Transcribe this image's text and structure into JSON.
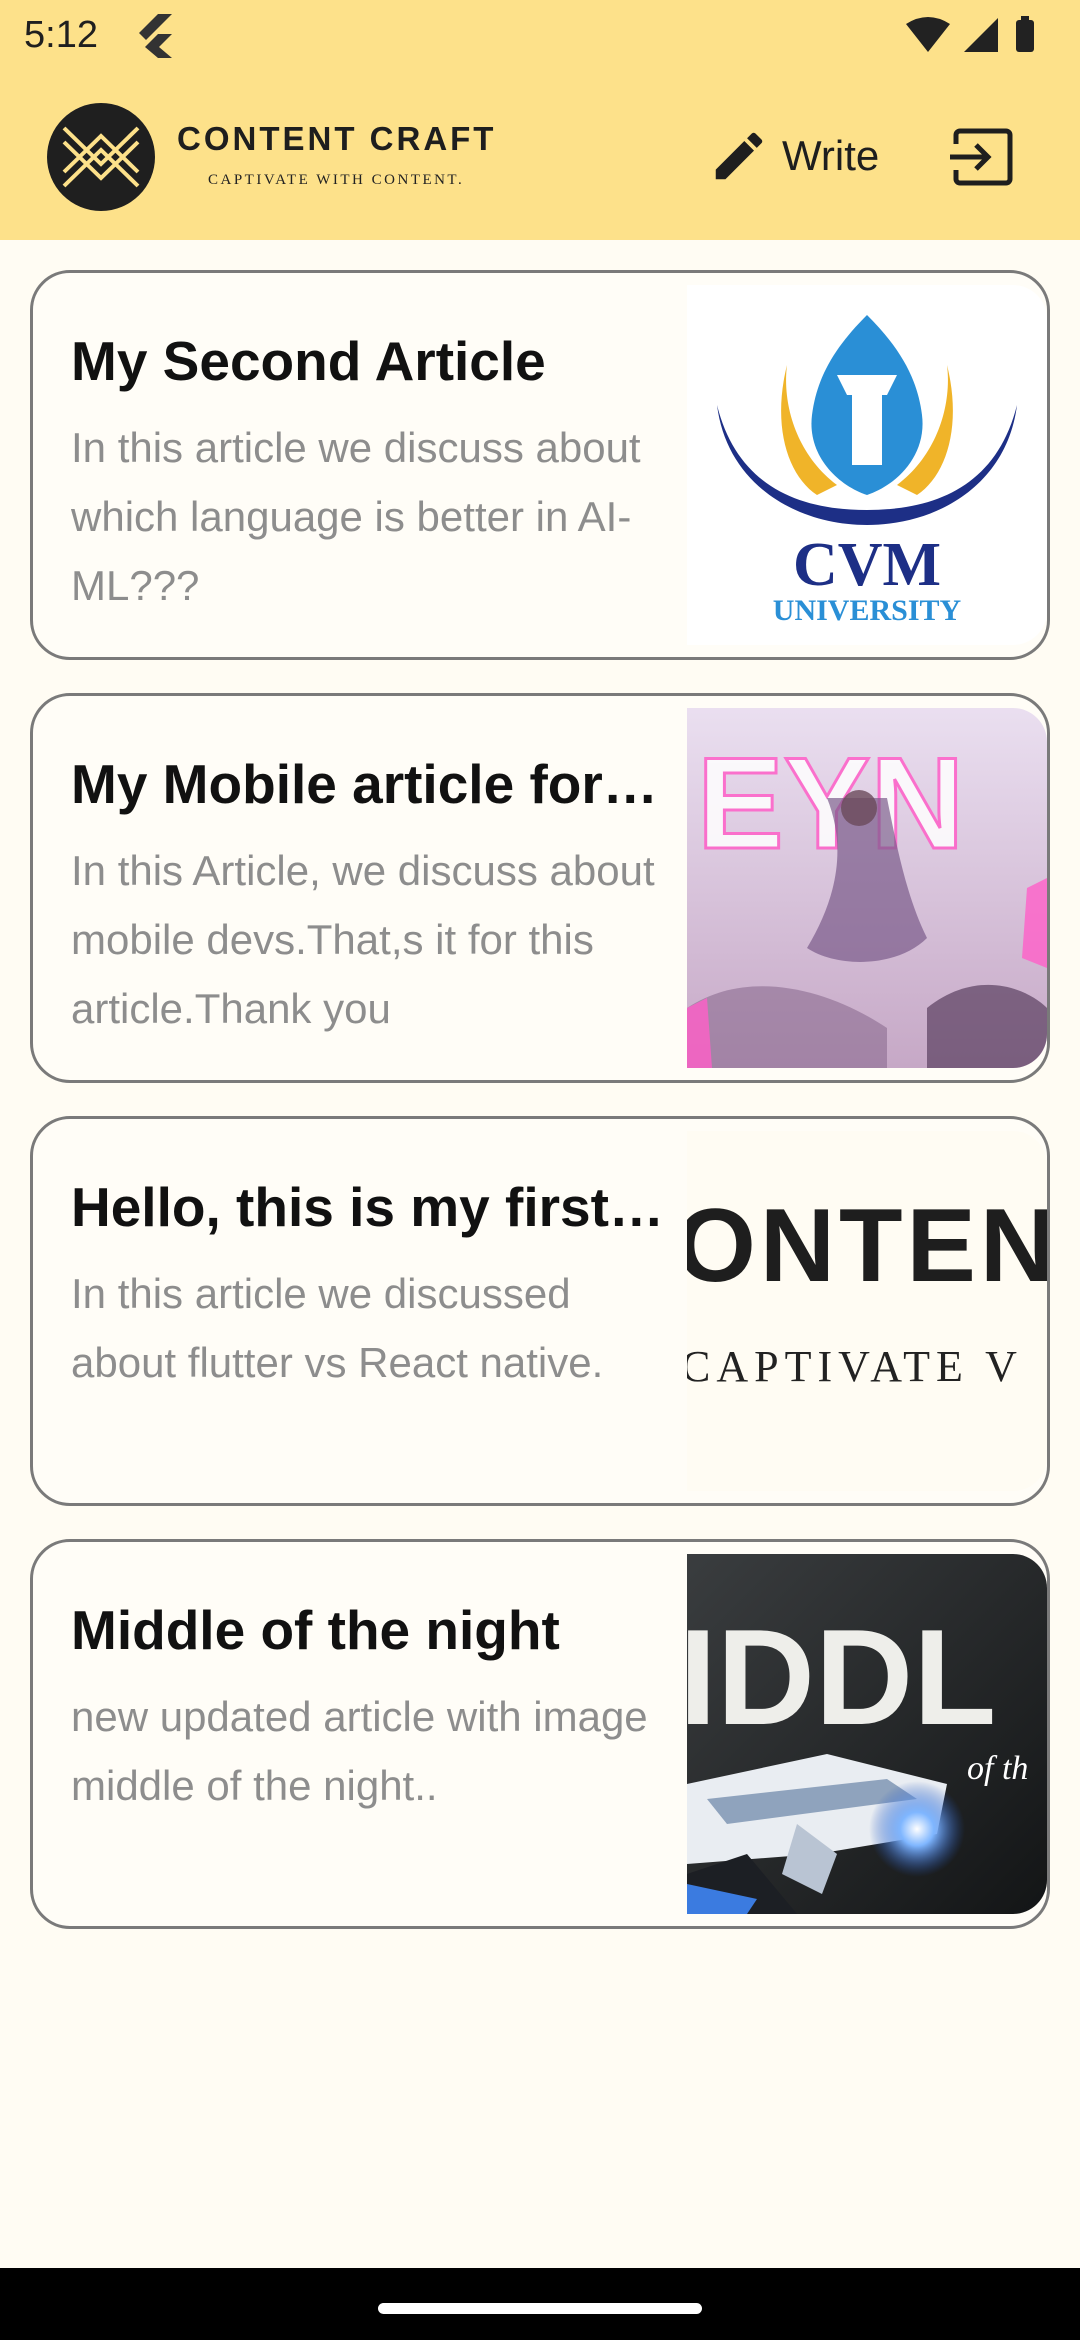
{
  "status_bar": {
    "time": "5:12"
  },
  "header": {
    "brand_name": "CONTENT CRAFT",
    "tagline": "CAPTIVATE WITH CONTENT.",
    "write_label": "Write",
    "colors": {
      "bar": "#fde18a",
      "background": "#fffcf3"
    }
  },
  "articles": [
    {
      "title": "My Second Article",
      "description": "In this article we discuss about which language is better in AI-ML???",
      "image": "cvm-university-logo",
      "image_text_top": "CVM",
      "image_text_bottom": "UNIVERSITY"
    },
    {
      "title": "My Mobile article for mobile devs",
      "description": "In this Article, we discuss about mobile devs.That,s it for this article.Thank you",
      "image": "game-character-artwork",
      "image_text": "EYN"
    },
    {
      "title": "Hello, this is my first article",
      "description": "In this article we discussed about flutter vs React native.",
      "image": "content-craft-banner",
      "image_text_top": "ONTEN",
      "image_text_bottom": "CAPTIVATE V"
    },
    {
      "title": "Middle of the night",
      "description": "new updated article with image middle of the night..",
      "image": "middle-of-the-night-artwork",
      "image_text": "IDDL",
      "image_text_small": "of th"
    }
  ]
}
